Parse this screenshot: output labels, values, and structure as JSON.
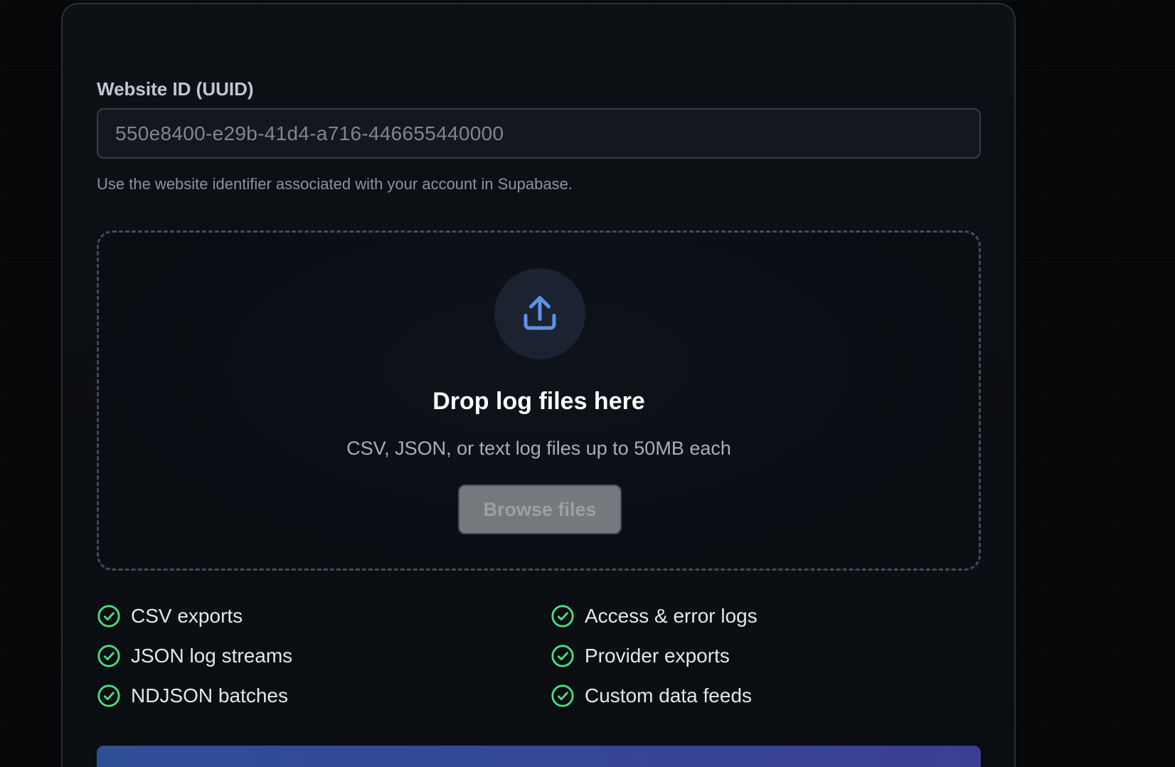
{
  "form": {
    "website_id_label": "Website ID (UUID)",
    "website_id_placeholder": "550e8400-e29b-41d4-a716-446655440000",
    "website_id_helper": "Use the website identifier associated with your account in Supabase."
  },
  "dropzone": {
    "icon": "upload-icon",
    "title": "Drop log files here",
    "subtitle": "CSV, JSON, or text log files up to 50MB each",
    "browse_label": "Browse files",
    "accent_color": "#5b93e6"
  },
  "features": {
    "left": [
      "CSV exports",
      "JSON log streams",
      "NDJSON batches"
    ],
    "right": [
      "Access & error logs",
      "Provider exports",
      "Custom data feeds"
    ],
    "check_color": "#4ade80"
  }
}
